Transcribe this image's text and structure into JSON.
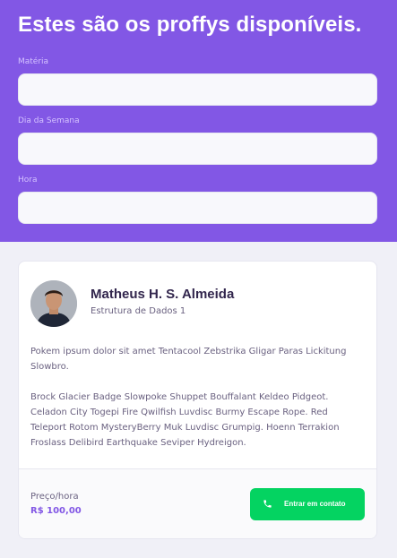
{
  "page": {
    "title": "Estes são os proffys disponíveis."
  },
  "filters": {
    "subject": {
      "label": "Matéria",
      "value": ""
    },
    "weekday": {
      "label": "Dia da Semana",
      "value": ""
    },
    "time": {
      "label": "Hora",
      "value": ""
    }
  },
  "teacher": {
    "name": "Matheus H. S. Almeida",
    "subject": "Estrutura de Dados 1",
    "bio": [
      "Pokem ipsum dolor sit amet Tentacool Zebstrika Gligar Paras Lickitung Slowbro.",
      "Brock Glacier Badge Slowpoke Shuppet Bouffalant Keldeo Pidgeot. Celadon City Togepi Fire Qwilfish Luvdisc Burmy Escape Rope. Red Teleport Rotom MysteryBerry Muk Luvdisc Grumpig. Hoenn Terrakion Froslass Delibird Earthquake Seviper Hydreigon."
    ],
    "price_label": "Preço/hora",
    "price_value": "R$ 100,00",
    "contact_label": "Entrar em contato"
  },
  "icons": {
    "contact": "whatsapp-icon",
    "avatar": "avatar"
  },
  "colors": {
    "primary": "#8257e5",
    "secondary": "#04d361",
    "background": "#f0f0f7"
  }
}
